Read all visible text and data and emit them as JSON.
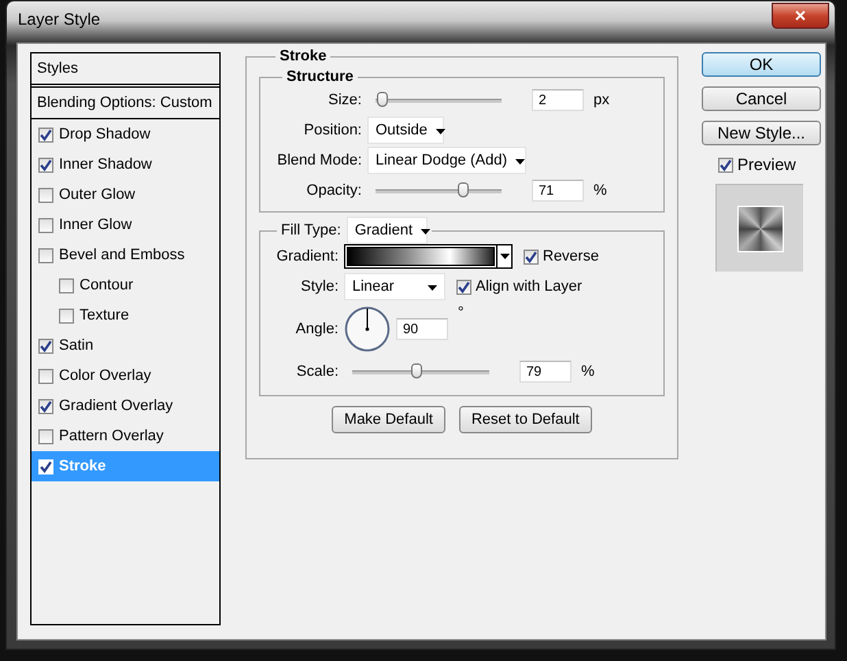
{
  "window": {
    "title": "Layer Style",
    "close": "×"
  },
  "sidebar": {
    "header": "Styles",
    "blending": "Blending Options: Custom",
    "items": [
      {
        "label": "Drop Shadow",
        "checked": true,
        "selected": false
      },
      {
        "label": "Inner Shadow",
        "checked": true,
        "selected": false
      },
      {
        "label": "Outer Glow",
        "checked": false,
        "selected": false
      },
      {
        "label": "Inner Glow",
        "checked": false,
        "selected": false
      },
      {
        "label": "Bevel and Emboss",
        "checked": false,
        "selected": false,
        "children": [
          {
            "label": "Contour",
            "checked": false,
            "selected": false
          },
          {
            "label": "Texture",
            "checked": false,
            "selected": false
          }
        ]
      },
      {
        "label": "Satin",
        "checked": true,
        "selected": false
      },
      {
        "label": "Color Overlay",
        "checked": false,
        "selected": false
      },
      {
        "label": "Gradient Overlay",
        "checked": true,
        "selected": false
      },
      {
        "label": "Pattern Overlay",
        "checked": false,
        "selected": false
      },
      {
        "label": "Stroke",
        "checked": true,
        "selected": true
      }
    ]
  },
  "panel": {
    "title": "Stroke",
    "structure": {
      "title": "Structure",
      "size": {
        "label": "Size:",
        "level": 0.01,
        "value": "2",
        "unit": "px"
      },
      "position": {
        "label": "Position:",
        "value": "Outside"
      },
      "blend_mode": {
        "label": "Blend Mode:",
        "value": "Linear Dodge (Add)"
      },
      "opacity": {
        "label": "Opacity:",
        "level": 0.71,
        "value": "71",
        "unit": "%"
      }
    },
    "fill": {
      "label": "Fill Type:",
      "value": "Gradient",
      "gradient": {
        "label": "Gradient:"
      },
      "reverse": {
        "label": "Reverse",
        "checked": true
      },
      "style": {
        "label": "Style:",
        "value": "Linear"
      },
      "align": {
        "label": "Align with Layer",
        "checked": true
      },
      "angle": {
        "label": "Angle:",
        "value": "90",
        "unit": "°"
      },
      "scale": {
        "label": "Scale:",
        "level": 0.47,
        "value": "79",
        "unit": "%"
      }
    },
    "buttons": [
      "Make Default",
      "Reset to Default"
    ]
  },
  "actions": {
    "buttons": [
      {
        "label": "OK",
        "kind": "default"
      },
      {
        "label": "Cancel",
        "kind": "normal"
      },
      {
        "label": "New Style...",
        "kind": "normal"
      }
    ],
    "preview": {
      "label": "Preview",
      "checked": true
    }
  }
}
